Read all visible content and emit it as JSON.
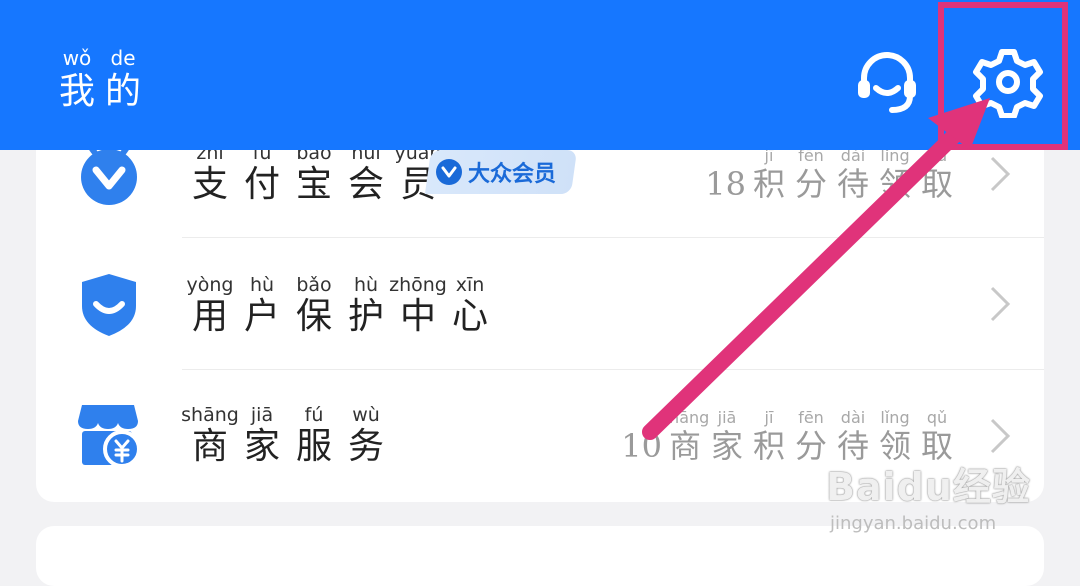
{
  "header": {
    "title_chars": [
      {
        "py": "wǒ",
        "hz": "我"
      },
      {
        "py": "de",
        "hz": "的"
      }
    ],
    "icons": [
      "headset-icon",
      "gear-icon"
    ],
    "background": "#1677ff"
  },
  "rows": [
    {
      "label_chars": [
        {
          "py": "zhī",
          "hz": "支"
        },
        {
          "py": "fù",
          "hz": "付"
        },
        {
          "py": "bǎo",
          "hz": "宝"
        },
        {
          "py": "huì",
          "hz": "会"
        },
        {
          "py": "yuán",
          "hz": "员"
        }
      ],
      "badge": "大众会员",
      "right_number": "18",
      "right_chars": [
        {
          "py": "jī",
          "hz": "积"
        },
        {
          "py": "fēn",
          "hz": "分"
        },
        {
          "py": "dài",
          "hz": "待"
        },
        {
          "py": "lǐng",
          "hz": "领"
        },
        {
          "py": "qǔ",
          "hz": "取"
        }
      ],
      "icon": "membership-v-icon"
    },
    {
      "label_chars": [
        {
          "py": "yòng",
          "hz": "用"
        },
        {
          "py": "hù",
          "hz": "户"
        },
        {
          "py": "bǎo",
          "hz": "保"
        },
        {
          "py": "hù",
          "hz": "护"
        },
        {
          "py": "zhōng",
          "hz": "中"
        },
        {
          "py": "xīn",
          "hz": "心"
        }
      ],
      "right_number": "",
      "right_chars": [],
      "icon": "shield-smile-icon"
    },
    {
      "label_chars": [
        {
          "py": "shāng",
          "hz": "商"
        },
        {
          "py": "jiā",
          "hz": "家"
        },
        {
          "py": "fú",
          "hz": "服"
        },
        {
          "py": "wù",
          "hz": "务"
        }
      ],
      "right_number": "10",
      "right_chars": [
        {
          "py": "shāng",
          "hz": "商"
        },
        {
          "py": "jiā",
          "hz": "家"
        },
        {
          "py": "jī",
          "hz": "积"
        },
        {
          "py": "fēn",
          "hz": "分"
        },
        {
          "py": "dài",
          "hz": "待"
        },
        {
          "py": "lǐng",
          "hz": "领"
        },
        {
          "py": "qǔ",
          "hz": "取"
        }
      ],
      "icon": "merchant-store-icon"
    }
  ],
  "watermark": {
    "logo": "Baidu经验",
    "url": "jingyan.baidu.com"
  },
  "colors": {
    "accent": "#1677ff",
    "annotation": "#e0337a",
    "icon_blue": "#2f80ed"
  }
}
